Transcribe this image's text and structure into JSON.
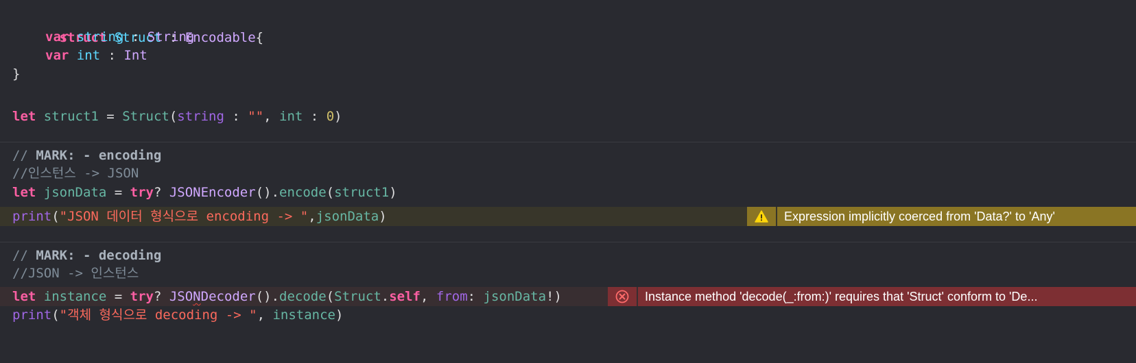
{
  "code": {
    "struct_decl": {
      "kw": "struct",
      "name": "Struct",
      "colon": " : ",
      "proto": "Encodable",
      "brace": "{"
    },
    "var_string": {
      "kw": "var",
      "name": "string",
      "colon": " : ",
      "type": "String"
    },
    "var_int": {
      "kw": "var",
      "name": "int",
      "colon": " : ",
      "type": "Int"
    },
    "close_brace": "}",
    "let_struct1": {
      "kw": "let",
      "name": "struct1",
      "eq": " = ",
      "call": "Struct",
      "open": "(",
      "arg1": "string",
      "c1": " : ",
      "v1": "\"\"",
      "comma": ", ",
      "arg2": "int",
      "c2": " : ",
      "v2": "0",
      "close": ")"
    },
    "mark_encoding": {
      "prefix": "// ",
      "mark": "MARK:",
      "rest": " - encoding"
    },
    "cmt_encoding": "//인스턴스 -> JSON",
    "let_jsondata": {
      "kw": "let",
      "name": "jsonData",
      "eq": " = ",
      "try": "try",
      "q": "? ",
      "cls": "JSONEncoder",
      "paren": "().",
      "method": "encode",
      "open": "(",
      "arg": "struct1",
      "close": ")"
    },
    "print_encoding": {
      "fn": "print",
      "open": "(",
      "str": "\"JSON 데이터 형식으로 encoding -> \"",
      "comma": ",",
      "arg": "jsonData",
      "close": ")"
    },
    "mark_decoding": {
      "prefix": "// ",
      "mark": "MARK:",
      "rest": " - decoding"
    },
    "cmt_decoding": "//JSON -> 인스턴스",
    "let_instance": {
      "kw": "let",
      "name": "instance",
      "eq": " = ",
      "try": "try",
      "q": "? ",
      "cls_a": "JSO",
      "cls_b": "N",
      "cls_c": "Decoder",
      "paren": "().",
      "method": "decode",
      "open": "(",
      "type": "Struct",
      "dot": ".",
      "self": "self",
      "comma": ", ",
      "label": "from",
      "colon": ": ",
      "arg": "jsonData",
      "bang": "!",
      "close": ")"
    },
    "print_decoding": {
      "fn": "print",
      "open": "(",
      "str": "\"객체 형식으로 decoding -> \"",
      "comma": ", ",
      "arg": "instance",
      "close": ")"
    }
  },
  "issues": {
    "warning": {
      "text": "Expression implicitly coerced from 'Data?' to 'Any'",
      "icon": "warning-triangle-icon",
      "color": "#8a7524"
    },
    "error": {
      "text": "Instance method 'decode(_:from:)' requires that 'Struct' conform to 'De...",
      "icon": "error-circle-icon",
      "color": "#7d2f33"
    }
  },
  "colors": {
    "background": "#292a30",
    "keyword": "#fc5fa3",
    "string": "#fc6a5d",
    "comment": "#7f8c98"
  }
}
